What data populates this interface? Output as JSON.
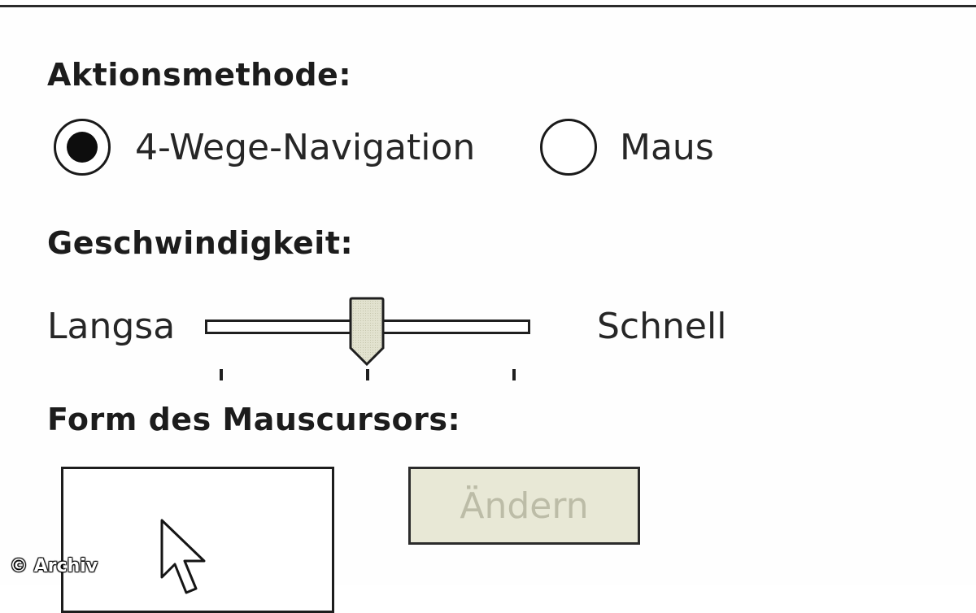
{
  "sections": {
    "action_method": "Aktionsmethode:",
    "speed": "Geschwindigkeit:",
    "cursor_shape": "Form des Mauscursors:"
  },
  "radio_options": [
    {
      "label": "4-Wege-Navigation",
      "selected": true
    },
    {
      "label": "Maus",
      "selected": false
    }
  ],
  "slider": {
    "min_label": "Langsa",
    "max_label": "Schnell",
    "value_fraction": 0.5,
    "tick_count": 3
  },
  "cursor_preview": {
    "icon": "arrow-cursor-icon"
  },
  "buttons": {
    "change_label": "Ändern",
    "change_enabled": false
  },
  "copyright": "© Archiv"
}
